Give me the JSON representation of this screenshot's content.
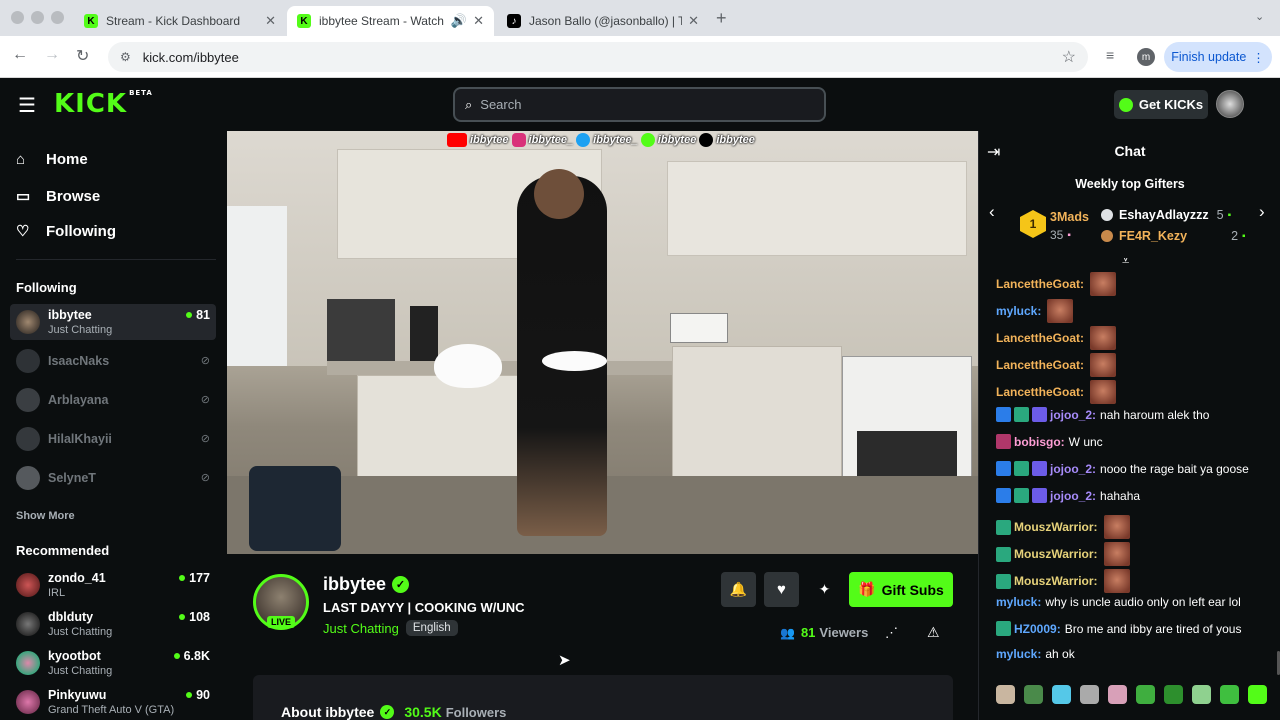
{
  "browser": {
    "tabs": [
      {
        "title": "Stream - Kick Dashboard"
      },
      {
        "title": "ibbytee Stream - Watch Li"
      },
      {
        "title": "Jason Ballo (@jasonballo) | Ti"
      }
    ],
    "url": "kick.com/ibbytee",
    "profile_initial": "m",
    "finish_update_label": "Finish update"
  },
  "header": {
    "logo": "KICK",
    "logo_sup": "BETA",
    "search_placeholder": "Search",
    "get_kicks_label": "Get KICKs"
  },
  "sidebar": {
    "nav": [
      {
        "label": "Home"
      },
      {
        "label": "Browse"
      },
      {
        "label": "Following"
      }
    ],
    "following_title": "Following",
    "following": [
      {
        "name": "ibbytee",
        "category": "Just Chatting",
        "viewers": "81"
      },
      {
        "name": "IsaacNaks"
      },
      {
        "name": "Arblayana"
      },
      {
        "name": "HilalKhayii"
      },
      {
        "name": "SelyneT"
      }
    ],
    "show_more": "Show More",
    "recommended_title": "Recommended",
    "recommended": [
      {
        "name": "zondo_41",
        "category": "IRL",
        "viewers": "177"
      },
      {
        "name": "dblduty",
        "category": "Just Chatting",
        "viewers": "108"
      },
      {
        "name": "kyootbot",
        "category": "Just Chatting",
        "viewers": "6.8K"
      },
      {
        "name": "Pinkyuwu",
        "category": "Grand Theft Auto V (GTA)",
        "viewers": "90"
      }
    ]
  },
  "video": {
    "overlay_handles": [
      "ibbytee",
      "ibbytee_",
      "ibbytee_",
      "ibbytee",
      "ibbytee"
    ]
  },
  "stream": {
    "streamer": "ibbytee",
    "live_label": "LIVE",
    "title": "LAST DAYYY | COOKING W/UNC",
    "category": "Just Chatting",
    "language": "English",
    "gift_subs_label": "Gift Subs",
    "viewers": "81",
    "viewers_label": "Viewers",
    "about_title": "About ibbytee",
    "followers": "30.5K",
    "followers_label": "Followers"
  },
  "chat": {
    "title": "Chat",
    "gifters_title": "Weekly top Gifters",
    "gifters": [
      {
        "rank": "1",
        "name": "3Mads",
        "count": "35"
      },
      {
        "name": "EshayAdlayzzz",
        "count": "5"
      },
      {
        "name": "FE4R_Kezy",
        "count": "2"
      }
    ],
    "messages": [
      {
        "user": "LancettheGoat:",
        "text": "",
        "color": "#f2b35a",
        "emote": true
      },
      {
        "user": "myluck:",
        "text": "",
        "color": "#5fa8ff",
        "emote": true
      },
      {
        "user": "LancettheGoat:",
        "text": "",
        "color": "#f2b35a",
        "emote": true
      },
      {
        "user": "LancettheGoat:",
        "text": "",
        "color": "#f2b35a",
        "emote": true
      },
      {
        "user": "LancettheGoat:",
        "text": "",
        "color": "#f2b35a",
        "emote": true
      },
      {
        "user": "jojoo_2:",
        "text": "nah haroum alek tho",
        "color": "#a78bfa",
        "badges": 3
      },
      {
        "user": "bobisgo:",
        "text": "W unc",
        "color": "#ff9fd6",
        "badges": 1
      },
      {
        "user": "jojoo_2:",
        "text": "nooo the rage bait ya goose",
        "color": "#a78bfa",
        "badges": 3
      },
      {
        "user": "jojoo_2:",
        "text": "hahaha",
        "color": "#a78bfa",
        "badges": 3
      },
      {
        "user": "MouszWarrior:",
        "text": "",
        "color": "#e6d27a",
        "badges": 1,
        "emote": true
      },
      {
        "user": "MouszWarrior:",
        "text": "",
        "color": "#e6d27a",
        "badges": 1,
        "emote": true
      },
      {
        "user": "MouszWarrior:",
        "text": "",
        "color": "#e6d27a",
        "badges": 1,
        "emote": true
      },
      {
        "user": "myluck:",
        "text": "why is uncle audio only on left ear lol",
        "color": "#5fa8ff"
      },
      {
        "user": "HZ0009:",
        "text": "Bro me and ibby are tired of yous",
        "color": "#5fa8ff",
        "badges": 1
      },
      {
        "user": "myluck:",
        "text": "ah ok",
        "color": "#5fa8ff"
      }
    ]
  },
  "colors": {
    "brand_green": "#53fc18",
    "background": "#0b0e0f"
  }
}
